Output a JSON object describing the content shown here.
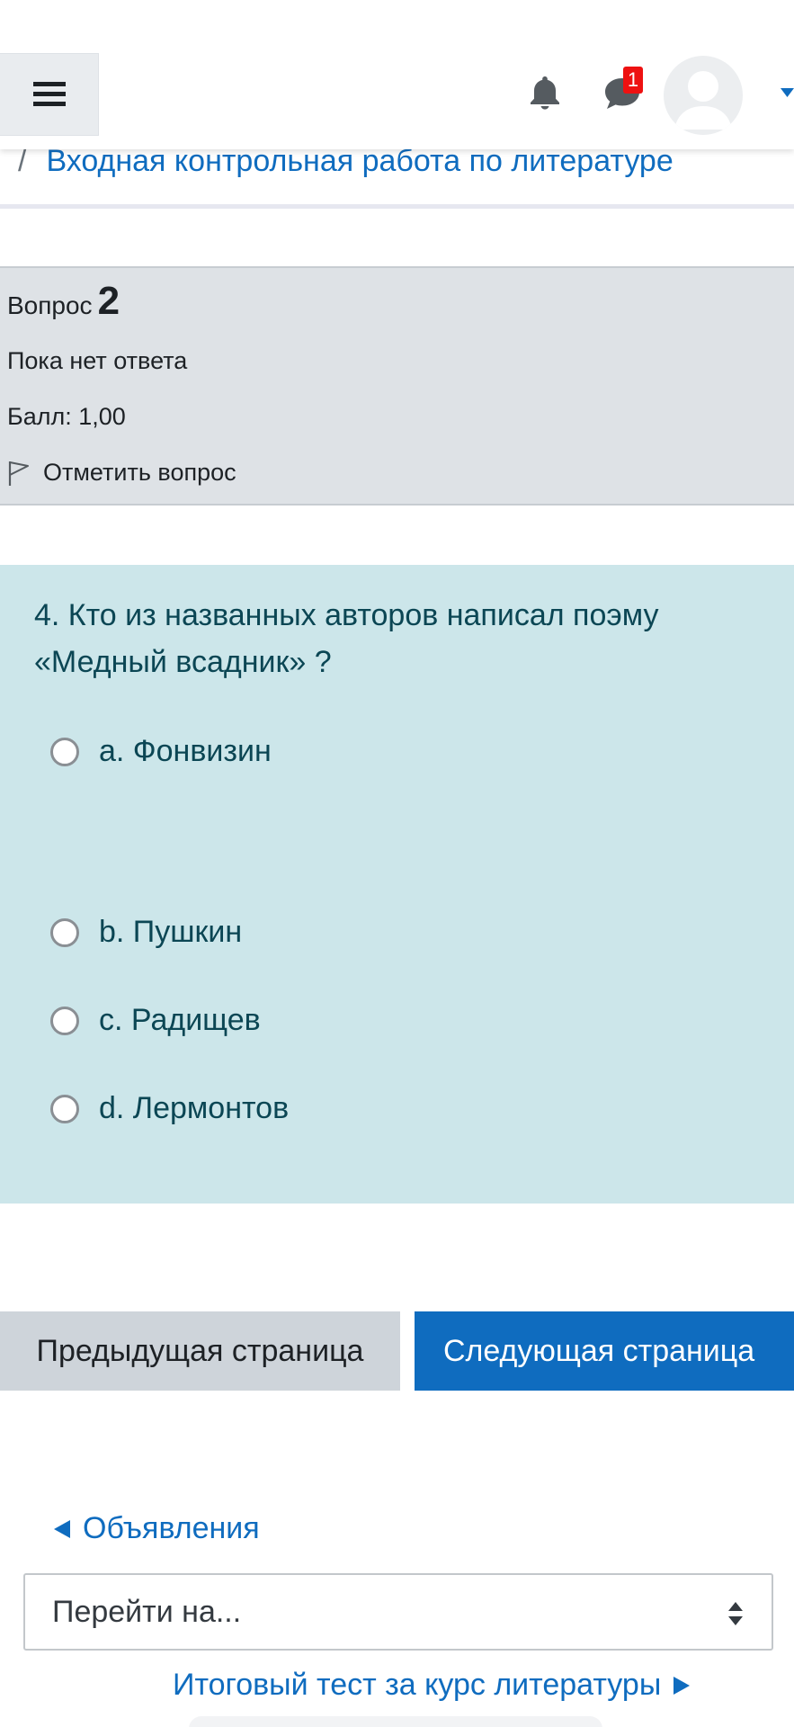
{
  "header": {
    "notification_count": "1",
    "icons": [
      "menu-icon",
      "bell-icon",
      "chat-icon",
      "avatar",
      "chevron-down-icon"
    ]
  },
  "breadcrumb": {
    "separator": "/",
    "current": "Входная контрольная работа по литературе"
  },
  "question_info": {
    "label": "Вопрос",
    "number": "2",
    "state": "Пока нет ответа",
    "grade": "Балл: 1,00",
    "flag_label": "Отметить вопрос"
  },
  "question": {
    "text": "4. Кто из названных авторов написал поэму «Медный всадник» ?",
    "answers": [
      {
        "label": "a. Фонвизин"
      },
      {
        "label": "b. Пушкин"
      },
      {
        "label": "c. Радищев"
      },
      {
        "label": "d. Лермонтов"
      }
    ]
  },
  "navigation": {
    "prev_label": "Предыдущая страница",
    "next_label": "Следующая страница"
  },
  "activity_nav": {
    "prev_activity": "Объявления",
    "jump_placeholder": "Перейти на...",
    "next_activity": "Итоговый тест за курс литературы"
  },
  "colors": {
    "accent": "#0f6cbf",
    "question_bg": "#cce6ea",
    "info_bg": "#dee2e6",
    "badge": "#ee1111"
  }
}
